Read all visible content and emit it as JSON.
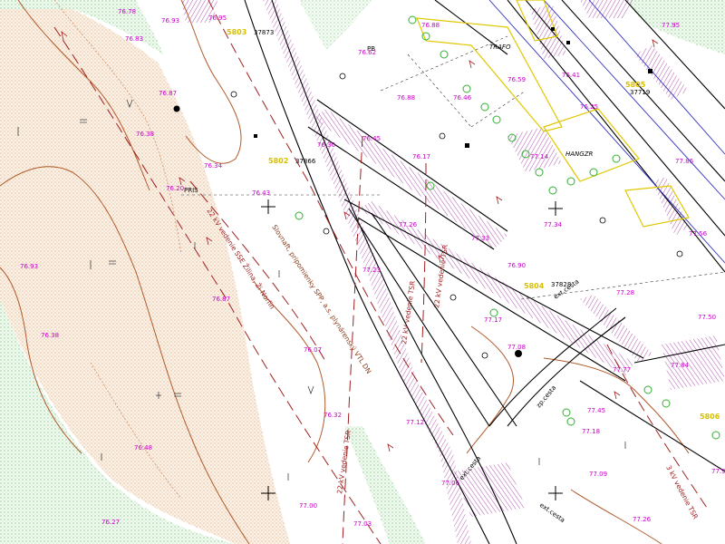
{
  "labels": {
    "trafo": "TRAFO",
    "hangar": "HANGZR",
    "pris1": "PRIS",
    "pris2": "PRIS",
    "pris3": "PRIS",
    "pb_label": "PB",
    "road_upper": "ext.cesta",
    "road_middle": "zp.cesta",
    "road_lower": "ext.cesta",
    "road_bottom": "ext.cesta",
    "red_line_1": "22 kV vedenie SSE Žilina, Ži Norfin",
    "red_line_2": "22 kV vedenie TSR",
    "red_line_3": "22 kV vedenie TSR",
    "red_line_4": "22 kV vedenie TSR",
    "red_line_5": "3 kV vedenie TSR",
    "brown_text": "Slovnaft, pripomienky SPP, a.s. plynárenský VTL DN"
  },
  "station_ids": [
    {
      "code": "5803",
      "number": "37873"
    },
    {
      "code": "5802",
      "number": "37866"
    },
    {
      "code": "5804",
      "number": "37828"
    },
    {
      "code": "5805",
      "number": "37719"
    },
    {
      "code": "5806",
      "number": ""
    }
  ],
  "spot_heights": [
    "76.78",
    "76.83",
    "76.93",
    "76.95",
    "76.87",
    "76.38",
    "76.34",
    "76.20",
    "76.93",
    "76.38",
    "76.48",
    "76.27",
    "76.87",
    "76.43",
    "76.07",
    "76.32",
    "77.00",
    "77.03",
    "77.12",
    "77.06",
    "77.17",
    "77.08",
    "77.45",
    "77.18",
    "77.09",
    "77.26",
    "77.77",
    "77.84",
    "77.50",
    "77.91",
    "77.56",
    "77.86",
    "76.62",
    "76.88",
    "76.17",
    "76.45",
    "76.30",
    "76.88",
    "76.46",
    "76.59",
    "76.41",
    "76.25",
    "77.14",
    "77.34",
    "76.90",
    "77.33",
    "77.26",
    "77.95",
    "77.28",
    "77.23"
  ],
  "colors": {
    "background": "#ffffff",
    "contour": "#b05a2a",
    "slope_fill": "#e8d4b8",
    "green_zone": "#9ed89e",
    "spot_height": "#c800c8",
    "power_line": "#a02020",
    "road": "#000000",
    "yellow_tag": "#d8c000",
    "hatch": "#9a2a9a"
  }
}
